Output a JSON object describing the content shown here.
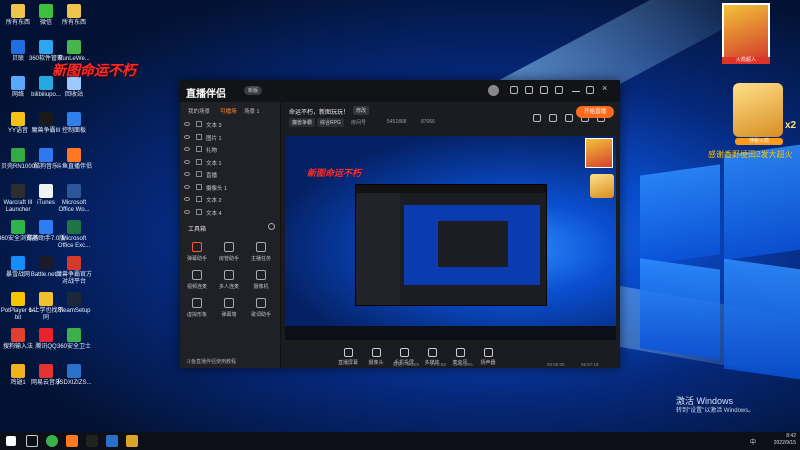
{
  "desktop": {
    "icons": [
      {
        "label": "所有东西",
        "color": "#f0c34a"
      },
      {
        "label": "微信",
        "color": "#3bc13b"
      },
      {
        "label": "所有东西",
        "color": "#f0c34a"
      },
      {
        "label": "贝联",
        "color": "#1f6fe0"
      },
      {
        "label": "360软件管家",
        "color": "#2ea5ef"
      },
      {
        "label": "RunLeWe...",
        "color": "#47b54a"
      },
      {
        "label": "网络",
        "color": "#5aa7ff"
      },
      {
        "label": "bilibiliupo...",
        "color": "#23a8e0"
      },
      {
        "label": "回收站",
        "color": "#9cc9ff"
      },
      {
        "label": "YY语音",
        "color": "#f5c116"
      },
      {
        "label": "魔兽争霸III",
        "color": "#1a1a1a"
      },
      {
        "label": "控制面板",
        "color": "#2f80ea"
      },
      {
        "label": "贝壳RN1000",
        "color": "#33aa44"
      },
      {
        "label": "酷狗音乐",
        "color": "#2e78f0"
      },
      {
        "label": "斗鱼直播伴侣",
        "color": "#ff7722"
      },
      {
        "label": "Warcraft III Launcher",
        "color": "#2d2d2d"
      },
      {
        "label": "iTunes",
        "color": "#f1f1f1"
      },
      {
        "label": "Microsoft Office Wo...",
        "color": "#2b579a"
      },
      {
        "label": "360安全浏览器",
        "color": "#2fb34a"
      },
      {
        "label": "酷狗助手7.0版",
        "color": "#2c7cf5"
      },
      {
        "label": "Microsoft Office Exc...",
        "color": "#217346"
      },
      {
        "label": "暴雪战网",
        "color": "#148eff"
      },
      {
        "label": "Battle.net...",
        "color": "#1a1a2a"
      },
      {
        "label": "魔兽争霸官方对战平台",
        "color": "#d33a2a"
      },
      {
        "label": "PotPlayer 64 bit",
        "color": "#f4c500"
      },
      {
        "label": "1.上学也找不同",
        "color": "#f2c12e"
      },
      {
        "label": "SteamSetup",
        "color": "#1b2838"
      },
      {
        "label": "搜狗输入法",
        "color": "#e04030"
      },
      {
        "label": "腾讯QQ",
        "color": "#e8232e"
      },
      {
        "label": "360安全卫士",
        "color": "#3ab14b"
      },
      {
        "label": "鸡翅1",
        "color": "#f2b21e"
      },
      {
        "label": "网易云音乐",
        "color": "#e3342f"
      },
      {
        "label": "JSDXIZIZS...",
        "color": "#2872c9"
      }
    ],
    "red_caption": "新图命运不朽",
    "gift1_label": "火箭超人",
    "gift2_label": "神秘火箭",
    "gift2_multiplier": "x2",
    "gift2_text": "感谢香野梗田2发大超火",
    "activate_title": "激活 Windows",
    "activate_sub": "转到\"设置\"以激活 Windows。"
  },
  "app": {
    "title": "直播伴侣",
    "title_badge": "新版",
    "tabs": [
      "我的场景",
      "可播场",
      "场景 1"
    ],
    "layers": [
      "文本 3",
      "图片 1",
      "礼物",
      "文本 1",
      "直播",
      "摄像头 1",
      "文本 2",
      "文本 4"
    ],
    "tools_header": "工具箱",
    "tools": [
      {
        "label": "弹幕助手"
      },
      {
        "label": "房管助手"
      },
      {
        "label": "主播任务"
      },
      {
        "label": "视频连麦"
      },
      {
        "label": "多人连麦"
      },
      {
        "label": "摄像机"
      },
      {
        "label": "虚拟形象"
      },
      {
        "label": "弹幕墙"
      },
      {
        "label": "歌词助手"
      }
    ],
    "left_footer": "斗鱼直播伴侣使用教程",
    "stream_title": "命运不朽，新图玩玩！",
    "edit_button": "修改",
    "category": "魔兽争霸",
    "tag": "综合RPG",
    "room_label": "房间号",
    "room_number": "5451868",
    "fans": "87066",
    "canvas_caption": "新图命运不朽",
    "bottom_tools": [
      {
        "label": "直播屏幕"
      },
      {
        "label": "摄像头"
      },
      {
        "label": "手机投屏"
      },
      {
        "label": "多媒体"
      },
      {
        "label": "麦克风"
      },
      {
        "label": "扬声器"
      }
    ],
    "live_button": "开始直播",
    "status_left": "网络：0KB/S",
    "status_fps": "FPS:60",
    "status_cpu": "CPU:38%",
    "status_time1": "00:00:00",
    "status_time2": "06:57:19"
  },
  "taskbar": {
    "time": "8:42",
    "date": "2022/9/15",
    "lang": "中"
  }
}
